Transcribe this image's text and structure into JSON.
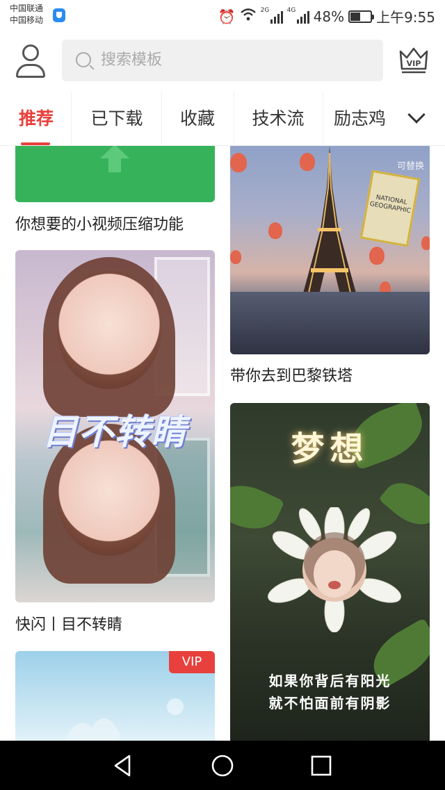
{
  "status_bar": {
    "carrier_1": "中国联通",
    "carrier_2": "中国移动",
    "net_1": "2G",
    "net_2": "4G",
    "battery": "48%",
    "time": "上午9:55"
  },
  "header": {
    "search_placeholder": "搜索模板",
    "vip_label": "VIP"
  },
  "tabs": [
    "推荐",
    "已下载",
    "收藏",
    "技术流",
    "励志鸡"
  ],
  "feed": {
    "left": [
      {
        "caption": "你想要的小视频压缩功能"
      },
      {
        "caption": "快闪丨目不转睛",
        "overlay_title": "目不转睛"
      },
      {
        "badge": "VIP"
      }
    ],
    "right": [
      {
        "caption": "带你去到巴黎铁塔",
        "corner_tag": "可替换",
        "magazine": "NATIONAL GEOGRAPHIC"
      },
      {
        "overlay_title": "梦想",
        "quote_1": "如果你背后有阳光",
        "quote_2": "就不怕面前有阴影"
      }
    ]
  },
  "colors": {
    "accent": "#e8403c",
    "green_card": "#36b35a",
    "text": "#222222",
    "placeholder": "#aaaaaa"
  }
}
